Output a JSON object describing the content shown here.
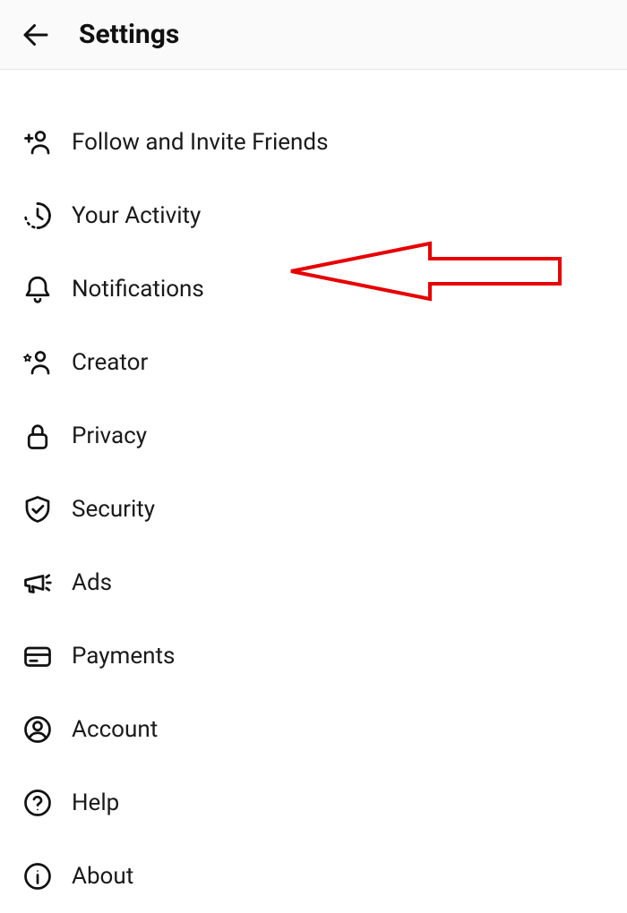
{
  "header": {
    "title": "Settings"
  },
  "menu": [
    {
      "label": "Follow and Invite Friends",
      "icon": "person-plus-icon",
      "key": "follow-invite"
    },
    {
      "label": "Your Activity",
      "icon": "activity-icon",
      "key": "your-activity"
    },
    {
      "label": "Notifications",
      "icon": "bell-icon",
      "key": "notifications"
    },
    {
      "label": "Creator",
      "icon": "creator-icon",
      "key": "creator"
    },
    {
      "label": "Privacy",
      "icon": "lock-icon",
      "key": "privacy"
    },
    {
      "label": "Security",
      "icon": "shield-check-icon",
      "key": "security"
    },
    {
      "label": "Ads",
      "icon": "megaphone-icon",
      "key": "ads"
    },
    {
      "label": "Payments",
      "icon": "card-icon",
      "key": "payments"
    },
    {
      "label": "Account",
      "icon": "account-icon",
      "key": "account"
    },
    {
      "label": "Help",
      "icon": "help-icon",
      "key": "help"
    },
    {
      "label": "About",
      "icon": "info-icon",
      "key": "about"
    }
  ],
  "annotation": {
    "highlight_target": "notifications",
    "color": "#e60000"
  }
}
